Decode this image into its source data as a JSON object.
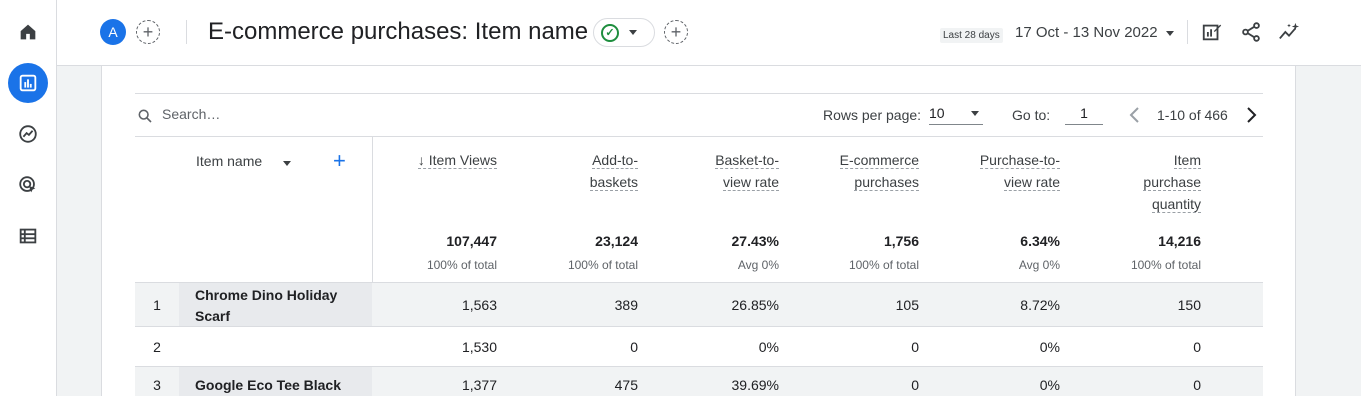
{
  "nav": {
    "items": [
      {
        "name": "home",
        "icon": "home-icon",
        "active": false
      },
      {
        "name": "reports",
        "icon": "bar-chart-icon",
        "active": true
      },
      {
        "name": "explore",
        "icon": "explore-icon",
        "active": false
      },
      {
        "name": "advertising",
        "icon": "ads-cursor-icon",
        "active": false
      },
      {
        "name": "configure",
        "icon": "list-icon",
        "active": false
      }
    ]
  },
  "header": {
    "avatar_letter": "A",
    "title": "E-commerce purchases: Item name",
    "date_label": "Last 28 days",
    "date_range": "17 Oct - 13 Nov 2022"
  },
  "toolbar": {
    "search_placeholder": "Search…",
    "rows_per_page_label": "Rows per page:",
    "rows_per_page_value": "10",
    "goto_label": "Go to:",
    "goto_value": "1",
    "pager_text": "1-10 of 466"
  },
  "table": {
    "dimension_header": "Item name",
    "columns": [
      {
        "line1": "↓ Item Views",
        "line2": "",
        "line3": ""
      },
      {
        "line1": "Add-to-",
        "line2": "baskets",
        "line3": ""
      },
      {
        "line1": "Basket-to-",
        "line2": "view rate",
        "line3": ""
      },
      {
        "line1": "E-commerce",
        "line2": "purchases",
        "line3": ""
      },
      {
        "line1": "Purchase-to-",
        "line2": "view rate",
        "line3": ""
      },
      {
        "line1": "Item",
        "line2": "purchase",
        "line3": "quantity"
      }
    ],
    "totals": [
      {
        "value": "107,447",
        "sub": "100% of total"
      },
      {
        "value": "23,124",
        "sub": "100% of total"
      },
      {
        "value": "27.43%",
        "sub": "Avg 0%"
      },
      {
        "value": "1,756",
        "sub": "100% of total"
      },
      {
        "value": "6.34%",
        "sub": "Avg 0%"
      },
      {
        "value": "14,216",
        "sub": "100% of total"
      }
    ],
    "rows": [
      {
        "num": "1",
        "name_line1": "Chrome Dino Holiday",
        "name_line2": "Scarf",
        "values": [
          "1,563",
          "389",
          "26.85%",
          "105",
          "8.72%",
          "150"
        ]
      },
      {
        "num": "2",
        "name_line1": "",
        "name_line2": "",
        "values": [
          "1,530",
          "0",
          "0%",
          "0",
          "0%",
          "0"
        ]
      },
      {
        "num": "3",
        "name_line1": "Google Eco Tee Black",
        "name_line2": "",
        "values": [
          "1,377",
          "475",
          "39.69%",
          "0",
          "0%",
          "0"
        ]
      }
    ]
  },
  "colors": {
    "accent": "#1a73e8",
    "success": "#1e8e3e"
  }
}
